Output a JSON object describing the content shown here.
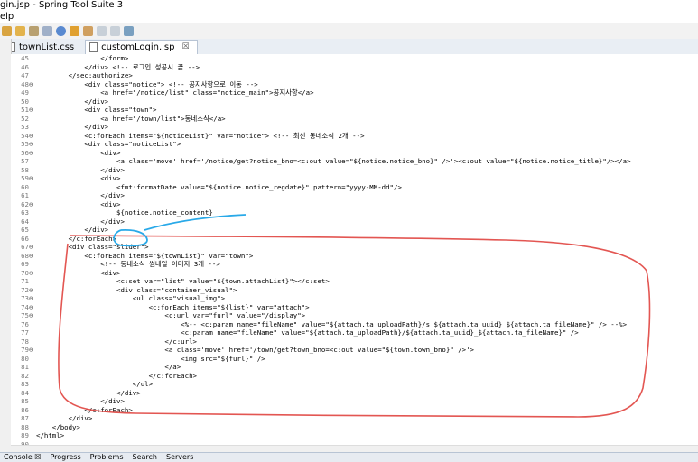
{
  "window": {
    "title": "gin.jsp - Spring Tool Suite 3"
  },
  "menu": {
    "items": [
      "elp"
    ]
  },
  "tabs": [
    {
      "label": "townList.css",
      "active": false
    },
    {
      "label": "customLogin.jsp",
      "active": true,
      "close": "☒"
    }
  ],
  "editor": {
    "lines": [
      {
        "n": "45",
        "fold": "",
        "code": "                </form>"
      },
      {
        "n": "46",
        "fold": "",
        "code": "            </div> <!-- 로그인 성공시 끝 -->"
      },
      {
        "n": "47",
        "fold": "",
        "code": "        </sec:authorize>"
      },
      {
        "n": "48",
        "fold": "⊖",
        "code": "            <div class=\"notice\"> <!-- 공지사항으로 이동 -->"
      },
      {
        "n": "49",
        "fold": "",
        "code": "                <a href=\"/notice/list\" class=\"notice_main\">공지사항</a>"
      },
      {
        "n": "50",
        "fold": "",
        "code": "            </div>"
      },
      {
        "n": "51",
        "fold": "⊖",
        "code": "            <div class=\"town\">"
      },
      {
        "n": "52",
        "fold": "",
        "code": "                <a href=\"/town/list\">동네소식</a>"
      },
      {
        "n": "53",
        "fold": "",
        "code": "            </div>"
      },
      {
        "n": "54",
        "fold": "⊖",
        "code": "            <c:forEach items=\"${noticeList}\" var=\"notice\"> <!-- 최신 동네소식 2개 -->"
      },
      {
        "n": "55",
        "fold": "⊖",
        "code": "            <div class=\"noticeList\">"
      },
      {
        "n": "56",
        "fold": "⊖",
        "code": "                <div>"
      },
      {
        "n": "57",
        "fold": "",
        "code": "                    <a class='move' href='/notice/get?notice_bno=<c:out value=\"${notice.notice_bno}\" />'><c:out value=\"${notice.notice_title}\"/></a>"
      },
      {
        "n": "58",
        "fold": "",
        "code": "                </div>"
      },
      {
        "n": "59",
        "fold": "⊖",
        "code": "                <div>"
      },
      {
        "n": "60",
        "fold": "",
        "code": "                    <fmt:formatDate value=\"${notice.notice_regdate}\" pattern=\"yyyy-MM-dd\"/>"
      },
      {
        "n": "61",
        "fold": "",
        "code": "                </div>"
      },
      {
        "n": "62",
        "fold": "⊖",
        "code": "                <div>"
      },
      {
        "n": "63",
        "fold": "",
        "code": "                    ${notice.notice_content}"
      },
      {
        "n": "64",
        "fold": "",
        "code": "                </div>"
      },
      {
        "n": "65",
        "fold": "",
        "code": "            </div>"
      },
      {
        "n": "66",
        "fold": "",
        "code": "        </c:forEach>"
      },
      {
        "n": "67",
        "fold": "⊖",
        "code": "        <div class=\"slider\">"
      },
      {
        "n": "68",
        "fold": "⊖",
        "code": "            <c:forEach items=\"${townList}\" var=\"town\">"
      },
      {
        "n": "69",
        "fold": "",
        "code": "                <!-- 동네소식 썸네일 이미지 3개 -->"
      },
      {
        "n": "70",
        "fold": "⊖",
        "code": "                <div>"
      },
      {
        "n": "71",
        "fold": "",
        "code": "                    <c:set var=\"list\" value=\"${town.attachList}\"></c:set>"
      },
      {
        "n": "72",
        "fold": "⊖",
        "code": "                    <div class=\"container_visual\">"
      },
      {
        "n": "73",
        "fold": "⊖",
        "code": "                        <ul class=\"visual_img\">"
      },
      {
        "n": "74",
        "fold": "⊖",
        "code": "                            <c:forEach items=\"${list}\" var=\"attach\">"
      },
      {
        "n": "75",
        "fold": "⊖",
        "code": "                                <c:url var=\"furl\" value=\"/display\">"
      },
      {
        "n": "76",
        "fold": "",
        "code": "                                    <%-- <c:param name=\"fileName\" value=\"${attach.ta_uploadPath}/s_${attach.ta_uuid}_${attach.ta_fileName}\" /> --%>"
      },
      {
        "n": "77",
        "fold": "",
        "code": "                                    <c:param name=\"fileName\" value=\"${attach.ta_uploadPath}/${attach.ta_uuid}_${attach.ta_fileName}\" />"
      },
      {
        "n": "78",
        "fold": "",
        "code": "                                </c:url>"
      },
      {
        "n": "79",
        "fold": "⊖",
        "code": "                                <a class='move' href='/town/get?town_bno=<c:out value=\"${town.town_bno}\" />'>"
      },
      {
        "n": "80",
        "fold": "",
        "code": "                                    <img src=\"${furl}\" />"
      },
      {
        "n": "81",
        "fold": "",
        "code": "                                </a>"
      },
      {
        "n": "82",
        "fold": "",
        "code": "                            </c:forEach>"
      },
      {
        "n": "83",
        "fold": "",
        "code": "                        </ul>"
      },
      {
        "n": "84",
        "fold": "",
        "code": "                    </div>"
      },
      {
        "n": "85",
        "fold": "",
        "code": "                </div>"
      },
      {
        "n": "86",
        "fold": "",
        "code": "            </c:forEach>"
      },
      {
        "n": "87",
        "fold": "",
        "code": "        </div>"
      },
      {
        "n": "88",
        "fold": "",
        "code": "    </body>"
      },
      {
        "n": "89",
        "fold": "",
        "code": "</html>"
      },
      {
        "n": "90",
        "fold": "",
        "code": ""
      }
    ]
  },
  "status": {
    "items": [
      "Console ☒",
      "Progress",
      "Problems",
      "Search",
      "Servers"
    ]
  },
  "colors": {
    "annotation_red": "#e0443f",
    "annotation_blue": "#29a9e8"
  }
}
